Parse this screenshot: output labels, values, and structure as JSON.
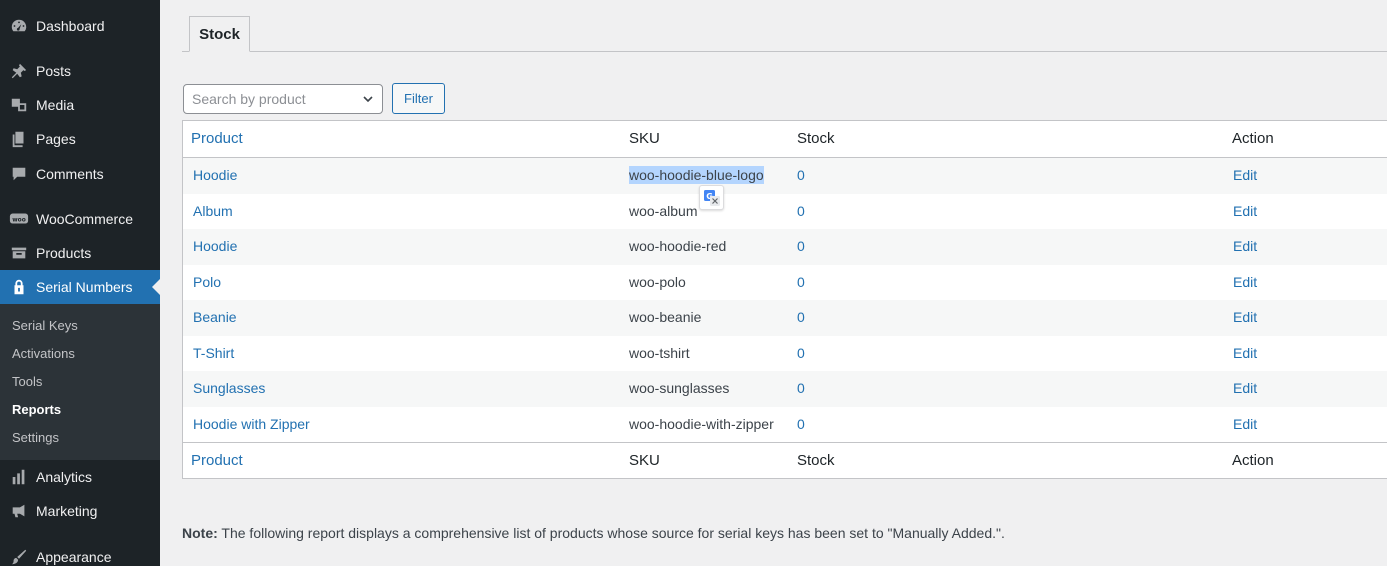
{
  "sidebar": {
    "items": [
      {
        "label": "Dashboard",
        "icon": "dashboard-icon"
      },
      {
        "label": "Posts",
        "icon": "pin-icon"
      },
      {
        "label": "Media",
        "icon": "media-icon"
      },
      {
        "label": "Pages",
        "icon": "pages-icon"
      },
      {
        "label": "Comments",
        "icon": "comment-icon"
      },
      {
        "label": "WooCommerce",
        "icon": "woo-icon"
      },
      {
        "label": "Products",
        "icon": "archive-icon"
      },
      {
        "label": "Serial Numbers",
        "icon": "lock-icon"
      },
      {
        "label": "Analytics",
        "icon": "bar-chart-icon"
      },
      {
        "label": "Marketing",
        "icon": "megaphone-icon"
      },
      {
        "label": "Appearance",
        "icon": "brush-icon"
      }
    ],
    "submenu": [
      {
        "label": "Serial Keys"
      },
      {
        "label": "Activations"
      },
      {
        "label": "Tools"
      },
      {
        "label": "Reports"
      },
      {
        "label": "Settings"
      }
    ]
  },
  "tabs": [
    {
      "label": "Stock"
    }
  ],
  "search": {
    "placeholder": "Search by product"
  },
  "filter": {
    "label": "Filter"
  },
  "table": {
    "columns": {
      "product": "Product",
      "sku": "SKU",
      "stock": "Stock",
      "action": "Action"
    },
    "rows": [
      {
        "product": "Hoodie",
        "sku": "woo-hoodie-blue-logo",
        "stock": "0",
        "action": "Edit"
      },
      {
        "product": "Album",
        "sku": "woo-album",
        "stock": "0",
        "action": "Edit"
      },
      {
        "product": "Hoodie",
        "sku": "woo-hoodie-red",
        "stock": "0",
        "action": "Edit"
      },
      {
        "product": "Polo",
        "sku": "woo-polo",
        "stock": "0",
        "action": "Edit"
      },
      {
        "product": "Beanie",
        "sku": "woo-beanie",
        "stock": "0",
        "action": "Edit"
      },
      {
        "product": "T-Shirt",
        "sku": "woo-tshirt",
        "stock": "0",
        "action": "Edit"
      },
      {
        "product": "Sunglasses",
        "sku": "woo-sunglasses",
        "stock": "0",
        "action": "Edit"
      },
      {
        "product": "Hoodie with Zipper",
        "sku": "woo-hoodie-with-zipper",
        "stock": "0",
        "action": "Edit"
      }
    ]
  },
  "note": {
    "label": "Note:",
    "text": " The following report displays a comprehensive list of products whose source for serial keys has been set to \"Manually Added.\"."
  },
  "colors": {
    "accent": "#2271b1",
    "sidebar": "#1d2327",
    "selection": "#b4d5fe"
  }
}
